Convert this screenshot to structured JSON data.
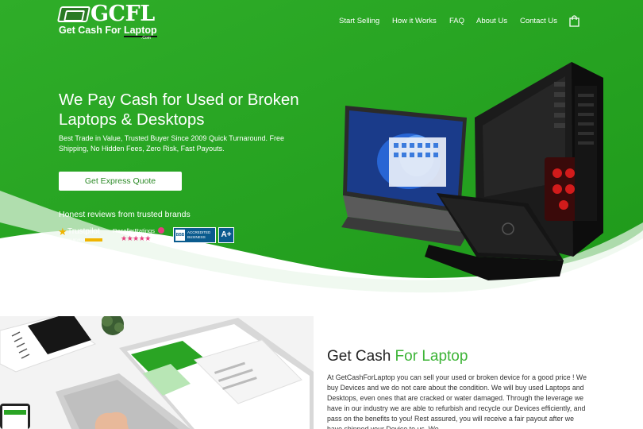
{
  "brand": {
    "logo_text": "GCFL",
    "logo_tagline_prefix": "Get Cash For ",
    "logo_tagline_highlight": "Laptop",
    "logo_domain": ".Com"
  },
  "nav": {
    "items": [
      "Start Selling",
      "How it Works",
      "FAQ",
      "About Us",
      "Contact Us"
    ],
    "cart_icon": "shopping-bag-icon"
  },
  "hero": {
    "headline": "We Pay Cash for Used or Broken Laptops & Desktops",
    "subcopy": "Best Trade in Value, Trusted Buyer Since 2009 Quick Turnaround. Free Shipping, No Hidden Fees, Zero Risk, Fast Payouts.",
    "cta_label": "Get Express Quote",
    "reviews_heading": "Honest reviews from trusted brands",
    "badges": {
      "trustpilot": {
        "name": "Trustpilot",
        "sub": "FIVE STAR REVIEWS"
      },
      "reseller": {
        "name": "ResellerRatings",
        "stars": "★★★★★"
      },
      "bbb": {
        "logo": "BBB",
        "line1": "ACCREDITED",
        "line2": "BUSINESS",
        "rating": "A+"
      }
    }
  },
  "section2": {
    "title_plain": "Get Cash ",
    "title_accent": "For Laptop",
    "body": "At GetCashForLaptop you can sell your used or broken device for a good price ! We buy Devices and we do not care about the condition. We will buy used Laptops and Desktops, even ones that are cracked or water damaged. Through the leverage we have in our industry we are able to refurbish and recycle our Devices efficiently, and pass on the benefits to you! Rest assured, you will receive a fair payout after we have shipped your Device to us. We"
  },
  "colors": {
    "hero_green": "#2aa424",
    "accent_green": "#3db437",
    "cta_text": "#2b8a26",
    "bbb_blue": "#0a5b8e",
    "trustpilot_star": "#f0b400",
    "reseller_pink": "#e64080"
  }
}
